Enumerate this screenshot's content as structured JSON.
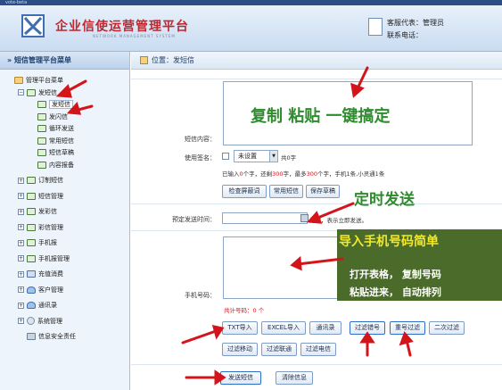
{
  "top_strip": "vote-beta",
  "header": {
    "brand": "企业信使运营管理平台",
    "brand_sub": "NETWORK MANAGEMENT SYSTEM",
    "user_label": "客服代表：管理员",
    "phone_label": "联系电话："
  },
  "sidebar": {
    "title": "» 短信管理平台菜单",
    "items": [
      {
        "label": "管理平台菜单",
        "icon": "home-icon"
      },
      {
        "label": "发短信",
        "icon": "sms-icon"
      },
      {
        "label": "发短信",
        "icon": "sms-icon"
      },
      {
        "label": "发闪信",
        "icon": "sms-icon"
      },
      {
        "label": "循环发送",
        "icon": "sms-icon"
      },
      {
        "label": "常用短信",
        "icon": "sms-icon"
      },
      {
        "label": "短信草稿",
        "icon": "sms-icon"
      },
      {
        "label": "内容报备",
        "icon": "sms-icon"
      },
      {
        "label": "订制短信",
        "icon": "sms-icon"
      },
      {
        "label": "短信管理",
        "icon": "sms-icon"
      },
      {
        "label": "发彩信",
        "icon": "sms-icon"
      },
      {
        "label": "彩信管理",
        "icon": "sms-icon"
      },
      {
        "label": "手机报",
        "icon": "sms-icon"
      },
      {
        "label": "手机报管理",
        "icon": "sms-icon"
      },
      {
        "label": "充值消费",
        "icon": "book-icon"
      },
      {
        "label": "客户管理",
        "icon": "user-icon"
      },
      {
        "label": "通讯录",
        "icon": "user-icon"
      },
      {
        "label": "系统管理",
        "icon": "gear-icon"
      },
      {
        "label": "信息安全责任",
        "icon": "safe-icon"
      }
    ]
  },
  "breadcrumb": "位置：发短信",
  "form": {
    "content_label": "短信内容：",
    "signature_label": "使用签名：",
    "signature_value": "未设置",
    "char_count_suffix": "共0字",
    "info_parts": [
      "已输入",
      "0",
      "个字，还剩",
      "300",
      "字，最多",
      "300",
      "个字，手机1条,小灵通1条"
    ],
    "btn_check": "检查屏蔽词",
    "btn_common": "常用短信",
    "btn_draft": "保存草稿",
    "schedule_label": "预定发送时间：",
    "schedule_hint": "为空，表示立即发送。",
    "phone_label": "手机号码：",
    "count_label": "共计号码：",
    "count_value": "0",
    "count_unit": "个",
    "btn_txt": "TXT导入",
    "btn_excel": "EXCEL导入",
    "btn_contacts": "通讯录",
    "btn_filter_err": "过滤错号",
    "btn_filter_dup": "重号过滤",
    "btn_filter_2": "二次过滤",
    "btn_filter_mobile": "过滤移动",
    "btn_filter_unicom": "过滤联通",
    "btn_filter_telecom": "过滤电信",
    "btn_send": "发送短信",
    "btn_clear": "清除信息"
  },
  "annotations": {
    "paste": "复制 粘贴 一键搞定",
    "timer": "定时发送",
    "import_title": "导入手机号码简单",
    "import_line1": "打开表格，  复制号码",
    "import_line2": "粘贴进来，  自动排列"
  },
  "colors": {
    "accent": "#3f6fb0",
    "annotation_green": "#2e8b2e",
    "arrow_red": "#d4141b",
    "panel_green": "#4a6b2a",
    "panel_yellow": "#f2e82a"
  }
}
